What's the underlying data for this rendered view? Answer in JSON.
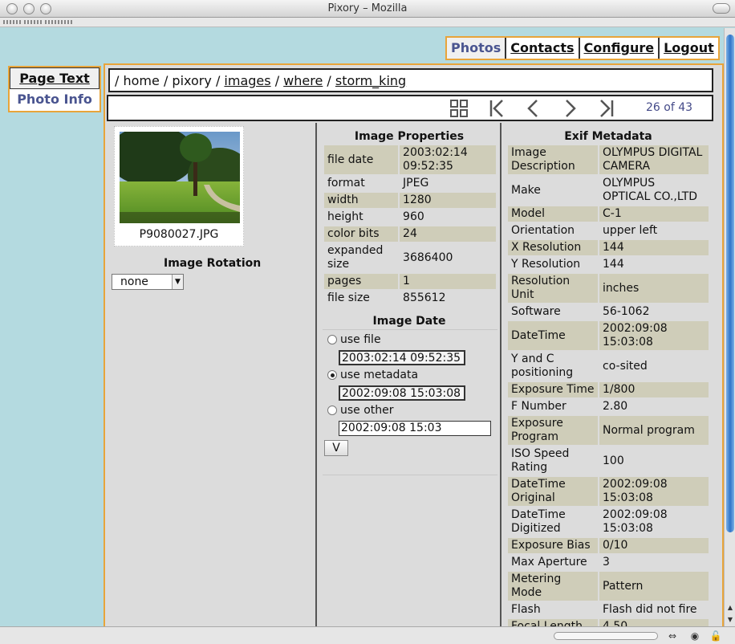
{
  "window": {
    "title": "Pixory – Mozilla"
  },
  "topnav": {
    "photos": "Photos",
    "contacts": "Contacts",
    "configure": "Configure",
    "logout": "Logout"
  },
  "sidetabs": {
    "page_text": "Page Text",
    "photo_info": "Photo Info"
  },
  "breadcrumb": {
    "sep": "/",
    "home": "home",
    "pixory": "pixory",
    "images": "images",
    "where": "where",
    "storm_king": "storm_king"
  },
  "pager": {
    "count": "26 of 43",
    "icons": [
      "grid-view-icon",
      "first-icon",
      "previous-icon",
      "next-icon",
      "last-icon"
    ]
  },
  "photo": {
    "filename": "P9080027.JPG"
  },
  "rotation": {
    "title": "Image Rotation",
    "selected": "none"
  },
  "properties": {
    "title": "Image Properties",
    "rows": [
      {
        "k": "file date",
        "v": "2003:02:14 09:52:35"
      },
      {
        "k": "format",
        "v": "JPEG"
      },
      {
        "k": "width",
        "v": "1280"
      },
      {
        "k": "height",
        "v": "960"
      },
      {
        "k": "color bits",
        "v": "24"
      },
      {
        "k": "expanded size",
        "v": "3686400"
      },
      {
        "k": "pages",
        "v": "1"
      },
      {
        "k": "file size",
        "v": "855612"
      }
    ]
  },
  "image_date": {
    "title": "Image Date",
    "use_file": "use file",
    "file_value": "2003:02:14 09:52:35",
    "use_metadata": "use metadata",
    "metadata_value": "2002:09:08 15:03:08",
    "use_other": "use other",
    "other_value": "2002:09:08 15:03",
    "button": "V",
    "selected": "use metadata"
  },
  "exif": {
    "title": "Exif Metadata",
    "rows": [
      {
        "k": "Image Description",
        "v": "OLYMPUS DIGITAL CAMERA"
      },
      {
        "k": "Make",
        "v": "OLYMPUS OPTICAL CO.,LTD"
      },
      {
        "k": "Model",
        "v": "C-1"
      },
      {
        "k": "Orientation",
        "v": "upper left"
      },
      {
        "k": "X Resolution",
        "v": "144"
      },
      {
        "k": "Y Resolution",
        "v": "144"
      },
      {
        "k": "Resolution Unit",
        "v": "inches"
      },
      {
        "k": "Software",
        "v": "56-1062"
      },
      {
        "k": "DateTime",
        "v": "2002:09:08 15:03:08"
      },
      {
        "k": "Y and C positioning",
        "v": "co-sited"
      },
      {
        "k": "Exposure Time",
        "v": "1/800"
      },
      {
        "k": "F Number",
        "v": "2.80"
      },
      {
        "k": "Exposure Program",
        "v": "Normal program"
      },
      {
        "k": "ISO Speed Rating",
        "v": "100"
      },
      {
        "k": "DateTime Original",
        "v": "2002:09:08 15:03:08"
      },
      {
        "k": "DateTime Digitized",
        "v": "2002:09:08 15:03:08"
      },
      {
        "k": "Exposure Bias",
        "v": "0/10"
      },
      {
        "k": "Max Aperture",
        "v": "3"
      },
      {
        "k": "Metering Mode",
        "v": "Pattern"
      },
      {
        "k": "Flash",
        "v": "Flash did not fire"
      },
      {
        "k": "Focal Length",
        "v": "4.50"
      }
    ]
  },
  "colors": {
    "accent_border": "#e8a43a",
    "page_bg": "#b4dae0",
    "alt_row": "#cfcdb9",
    "active_tab": "#4a5590"
  }
}
